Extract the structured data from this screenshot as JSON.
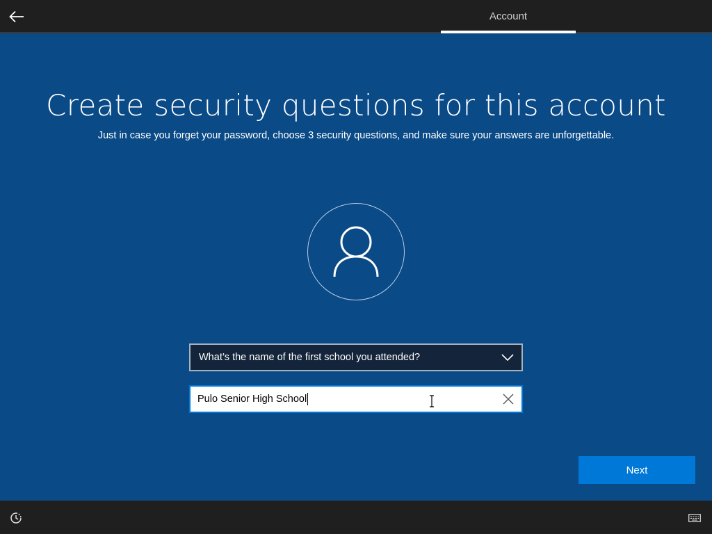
{
  "header": {
    "tab_label": "Account",
    "back_icon": "arrow-left-icon"
  },
  "main": {
    "title": "Create security questions for this account",
    "subtitle": "Just in case you forget your password, choose 3 security questions, and make sure your answers are unforgettable.",
    "avatar_icon": "user-icon",
    "question": {
      "selected": "What’s the name of the first school you attended?",
      "icon": "chevron-down-icon"
    },
    "answer": {
      "value": "Pulo Senior High School",
      "clear_icon": "close-icon"
    },
    "next_label": "Next"
  },
  "footer": {
    "ease_of_access_icon": "ease-of-access-icon",
    "keyboard_icon": "keyboard-icon"
  },
  "colors": {
    "background": "#0a4a87",
    "bar": "#1f1f1f",
    "accent": "#0078d7",
    "select_bg": "#14243a"
  }
}
